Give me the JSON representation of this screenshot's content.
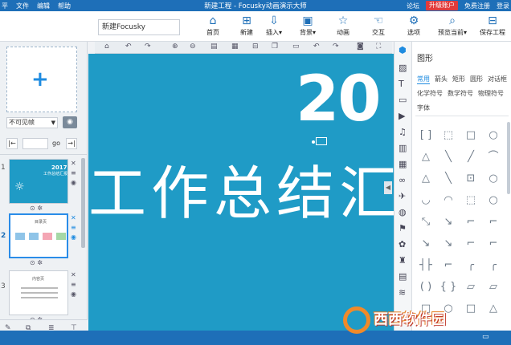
{
  "titlebar": {
    "app_icon": "平",
    "menu": [
      "文件",
      "编辑",
      "帮助"
    ],
    "title": "新建工程 - Focusky动画演示大师",
    "forum": "论坛",
    "upgrade": "升级账户",
    "register": "免费注册",
    "login": "登录",
    "bg_color": "#1e6fb8",
    "upgrade_color": "#e23b3b"
  },
  "toolbar": {
    "project_name": "新建Focusky",
    "buttons": [
      {
        "label": "首页",
        "icon": "home-icon",
        "glyph": "⌂"
      },
      {
        "label": "新建",
        "icon": "new-icon",
        "glyph": "⊞"
      },
      {
        "label": "插入",
        "icon": "insert-icon",
        "glyph": "⇩",
        "dropdown": "▾"
      },
      {
        "label": "背景",
        "icon": "background-icon",
        "glyph": "▣",
        "dropdown": "▾"
      },
      {
        "label": "动画",
        "icon": "animation-icon",
        "glyph": "☆"
      },
      {
        "label": "交互",
        "icon": "interaction-icon",
        "glyph": "☜"
      },
      {
        "label": "选项",
        "icon": "options-icon",
        "glyph": "⚙"
      },
      {
        "label": "预览当前",
        "icon": "preview-icon",
        "glyph": "⌕",
        "dropdown": "▾"
      },
      {
        "label": "保存工程",
        "icon": "save-icon",
        "glyph": "⊟"
      }
    ]
  },
  "left_panel": {
    "add_frame_glyph": "+",
    "frame_mode": "不可见帧",
    "goto_label": "go",
    "thumbnails": [
      {
        "num": "1",
        "title": "2017",
        "subtitle": "工作总结汇报"
      },
      {
        "num": "2",
        "title": "目录页"
      },
      {
        "num": "3",
        "title": "内容页"
      },
      {
        "num": "4",
        "title": ""
      }
    ]
  },
  "canvas": {
    "year_text": "20",
    "title_text": "工作总结汇",
    "bg_color": "#1f9bc6"
  },
  "shapes_panel": {
    "header": "图形",
    "categories_row1": [
      "常用",
      "箭头",
      "矩形",
      "圆形",
      "对话框"
    ],
    "categories_row2": [
      "化学符号",
      "数学符号",
      "物理符号"
    ],
    "categories_row3": [
      "字体"
    ],
    "active_category": "常用",
    "shapes": [
      "[ ]",
      "⬚",
      "□",
      "○",
      "△",
      "╲",
      "╱",
      "⌒",
      "△",
      "╲",
      "⊡",
      "○",
      "◡",
      "◠",
      "⬚",
      "○",
      "⤡",
      "↘",
      "⌐",
      "⌐",
      "↘",
      "↘",
      "⌐",
      "⌐",
      "┤├",
      "⌐",
      "╭",
      "╭",
      "( )",
      "{ }",
      "▱",
      "▱",
      "□",
      "○",
      "□",
      "△"
    ]
  },
  "watermark": {
    "main": "西西软件园",
    "sub": "CR173.COM"
  }
}
